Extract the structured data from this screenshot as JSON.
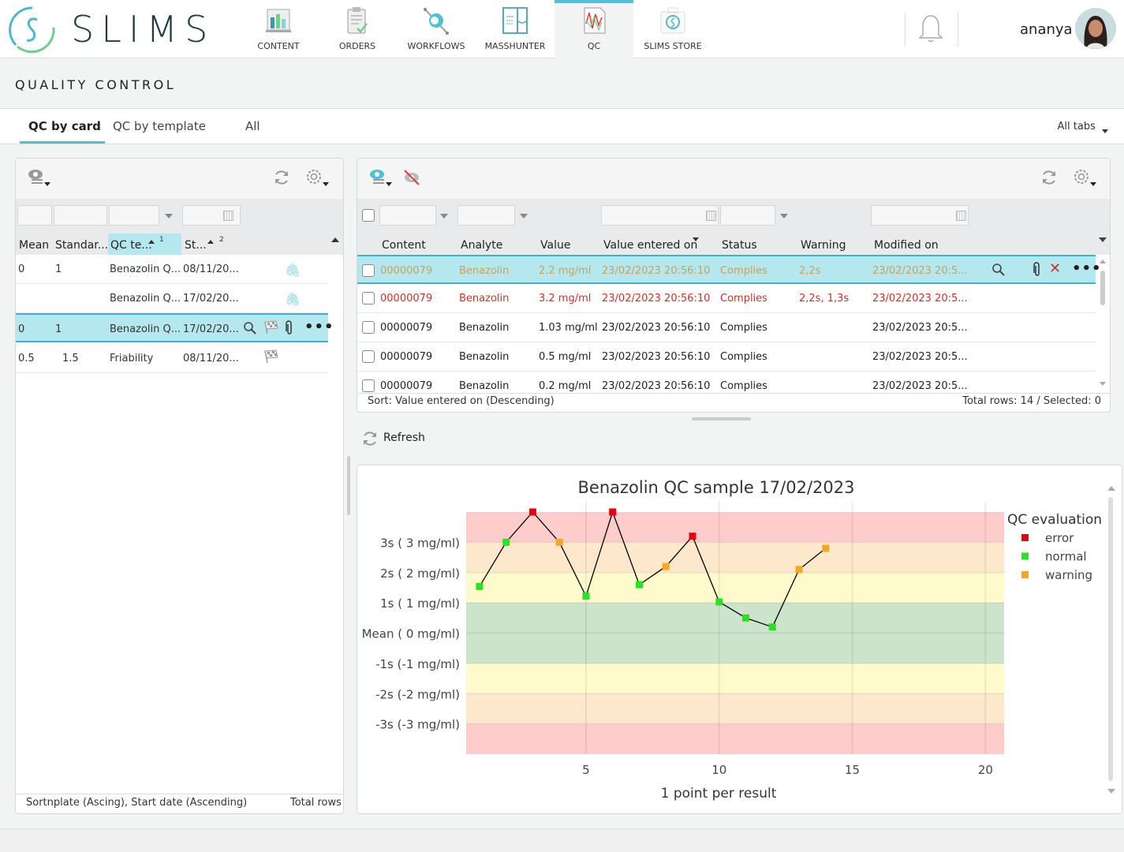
{
  "app": {
    "logo_text": "SLIMS",
    "nav": [
      {
        "label": "CONTENT",
        "icon": "content-icon",
        "active": false
      },
      {
        "label": "ORDERS",
        "icon": "orders-icon",
        "active": false
      },
      {
        "label": "WORKFLOWS",
        "icon": "workflows-icon",
        "active": false
      },
      {
        "label": "MASSHUNTER",
        "icon": "masshunter-icon",
        "active": false
      },
      {
        "label": "QC",
        "icon": "qc-icon",
        "active": true
      },
      {
        "label": "SLIMS STORE",
        "icon": "store-icon",
        "active": false
      }
    ],
    "user": {
      "name": "ananya"
    },
    "accent": "#4bc3d3"
  },
  "page": {
    "title": "QUALITY CONTROL",
    "tabs": [
      {
        "label": "QC by card",
        "active": true
      },
      {
        "label": "QC by template",
        "active": false
      },
      {
        "label": "All",
        "active": false
      }
    ],
    "all_tabs_label": "All tabs"
  },
  "left_table": {
    "columns": [
      "Mean",
      "Standar...",
      "QC te...",
      "St..."
    ],
    "sort_markers": [
      "1",
      "2"
    ],
    "rows": [
      {
        "mean": "0",
        "std": "1",
        "template": "Benazolin Q...",
        "start": "08/11/20...",
        "selected": false,
        "icons": [
          "paperclip"
        ]
      },
      {
        "mean": "",
        "std": "",
        "template": "Benazolin Q...",
        "start": "17/02/20...",
        "selected": false,
        "icons": [
          "paperclip"
        ]
      },
      {
        "mean": "0",
        "std": "1",
        "template": "Benazolin Q...",
        "start": "17/02/20...",
        "selected": true,
        "icons": [
          "search",
          "flag",
          "paperclip",
          "more"
        ]
      },
      {
        "mean": "0.5",
        "std": "1.5",
        "template": "Friability",
        "start": "08/11/20...",
        "selected": false,
        "icons": [
          "flag"
        ]
      }
    ],
    "footer_sort": "Sortnplate (Ascing), Start date (Ascending)",
    "footer_total": "Total rows"
  },
  "right_table": {
    "columns": [
      "Content",
      "Analyte",
      "Value",
      "Value entered on",
      "Status",
      "Warning",
      "Modified on"
    ],
    "rows": [
      {
        "content": "00000079",
        "analyte": "Benazolin",
        "value": "2.2 mg/ml",
        "entered": "23/02/2023 20:56:10",
        "status": "Complies",
        "warning": "2,2s",
        "modified": "23/02/2023 20:5...",
        "tone": "warning",
        "selected": true
      },
      {
        "content": "00000079",
        "analyte": "Benazolin",
        "value": "3.2 mg/ml",
        "entered": "23/02/2023 20:56:10",
        "status": "Complies",
        "warning": "2,2s, 1,3s",
        "modified": "23/02/2023 20:5...",
        "tone": "error",
        "selected": false
      },
      {
        "content": "00000079",
        "analyte": "Benazolin",
        "value": "1.03 mg/ml",
        "entered": "23/02/2023 20:56:10",
        "status": "Complies",
        "warning": "",
        "modified": "23/02/2023 20:5...",
        "tone": "normal",
        "selected": false
      },
      {
        "content": "00000079",
        "analyte": "Benazolin",
        "value": "0.5 mg/ml",
        "entered": "23/02/2023 20:56:10",
        "status": "Complies",
        "warning": "",
        "modified": "23/02/2023 20:5...",
        "tone": "normal",
        "selected": false
      },
      {
        "content": "00000079",
        "analyte": "Benazolin",
        "value": "0.2 mg/ml",
        "entered": "23/02/2023 20:56:10",
        "status": "Complies",
        "warning": "",
        "modified": "23/02/2023 20:5...",
        "tone": "normal",
        "selected": false
      }
    ],
    "footer_sort": "Sort: Value entered on (Descending)",
    "footer_total": "Total rows: 14 / Selected: 0",
    "tone_colors": {
      "warning": "#c8a060",
      "error": "#d0302a",
      "normal": "#222222"
    }
  },
  "refresh_label": "Refresh",
  "chart_data": {
    "type": "scatter",
    "title": "Benazolin QC sample 17/02/2023",
    "xlabel": "1 point per result",
    "ylabel": "",
    "x_ticks": [
      5,
      10,
      15,
      20
    ],
    "xlim": [
      0.5,
      20.7
    ],
    "ylim": [
      -4,
      4
    ],
    "y_ticks": [
      {
        "value": 3,
        "label": "3s ( 3 mg/ml)"
      },
      {
        "value": 2,
        "label": "2s ( 2 mg/ml)"
      },
      {
        "value": 1,
        "label": "1s ( 1 mg/ml)"
      },
      {
        "value": 0,
        "label": "Mean ( 0 mg/ml)"
      },
      {
        "value": -1,
        "label": "-1s (-1 mg/ml)"
      },
      {
        "value": -2,
        "label": "-2s (-2 mg/ml)"
      },
      {
        "value": -3,
        "label": "-3s (-3 mg/ml)"
      }
    ],
    "bands": [
      {
        "from": 3,
        "to": 4,
        "color": "#ffcccc"
      },
      {
        "from": 2,
        "to": 3,
        "color": "#fde8cc"
      },
      {
        "from": 1,
        "to": 2,
        "color": "#fffacc"
      },
      {
        "from": -1,
        "to": 1,
        "color": "#cce3cc"
      },
      {
        "from": -2,
        "to": -1,
        "color": "#fffacc"
      },
      {
        "from": -3,
        "to": -2,
        "color": "#fde8cc"
      },
      {
        "from": -4,
        "to": -3,
        "color": "#ffcccc"
      }
    ],
    "legend_title": "QC evaluation",
    "legend_position": "right",
    "legend": [
      {
        "name": "error",
        "color": "#e8000b"
      },
      {
        "name": "normal",
        "color": "#22e622"
      },
      {
        "name": "warning",
        "color": "#f5a623"
      }
    ],
    "points": [
      {
        "x": 1,
        "y": 1.54,
        "eval": "normal"
      },
      {
        "x": 2,
        "y": 3.0,
        "eval": "normal"
      },
      {
        "x": 3,
        "y": 4.0,
        "eval": "error"
      },
      {
        "x": 4,
        "y": 3.0,
        "eval": "warning"
      },
      {
        "x": 5,
        "y": 1.22,
        "eval": "normal"
      },
      {
        "x": 6,
        "y": 4.0,
        "eval": "error"
      },
      {
        "x": 7,
        "y": 1.6,
        "eval": "normal"
      },
      {
        "x": 8,
        "y": 2.2,
        "eval": "warning"
      },
      {
        "x": 9,
        "y": 3.2,
        "eval": "error"
      },
      {
        "x": 10,
        "y": 1.03,
        "eval": "normal"
      },
      {
        "x": 11,
        "y": 0.5,
        "eval": "normal"
      },
      {
        "x": 12,
        "y": 0.2,
        "eval": "normal"
      },
      {
        "x": 13,
        "y": 2.1,
        "eval": "warning"
      },
      {
        "x": 14,
        "y": 2.8,
        "eval": "warning"
      }
    ]
  }
}
